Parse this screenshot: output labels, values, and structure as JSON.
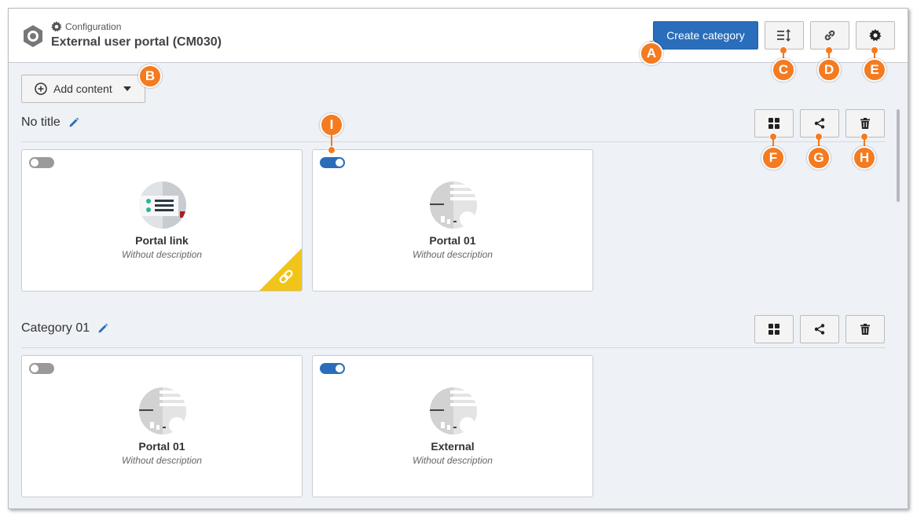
{
  "header": {
    "breadcrumb": "Configuration",
    "title": "External user portal (CM030)",
    "create_button": "Create category"
  },
  "toolbar": {
    "add_content": "Add content"
  },
  "sections": [
    {
      "title": "No title",
      "cards": [
        {
          "name": "Portal link",
          "description": "Without description",
          "enabled": false,
          "type": "link"
        },
        {
          "name": "Portal 01",
          "description": "Without description",
          "enabled": true,
          "type": "portal"
        }
      ]
    },
    {
      "title": "Category 01",
      "cards": [
        {
          "name": "Portal 01",
          "description": "Without description",
          "enabled": false,
          "type": "portal"
        },
        {
          "name": "External",
          "description": "Without description",
          "enabled": true,
          "type": "portal"
        }
      ]
    }
  ],
  "callouts": [
    "A",
    "B",
    "C",
    "D",
    "E",
    "F",
    "G",
    "H",
    "I"
  ],
  "colors": {
    "accent": "#2a6ebb",
    "callout": "#f47b20",
    "badge": "#f0c419"
  },
  "icons": [
    "gear-icon",
    "sort-icon",
    "link-icon",
    "grid-icon",
    "share-icon",
    "trash-icon",
    "edit-icon",
    "plus-circle-icon",
    "caret-down-icon"
  ]
}
